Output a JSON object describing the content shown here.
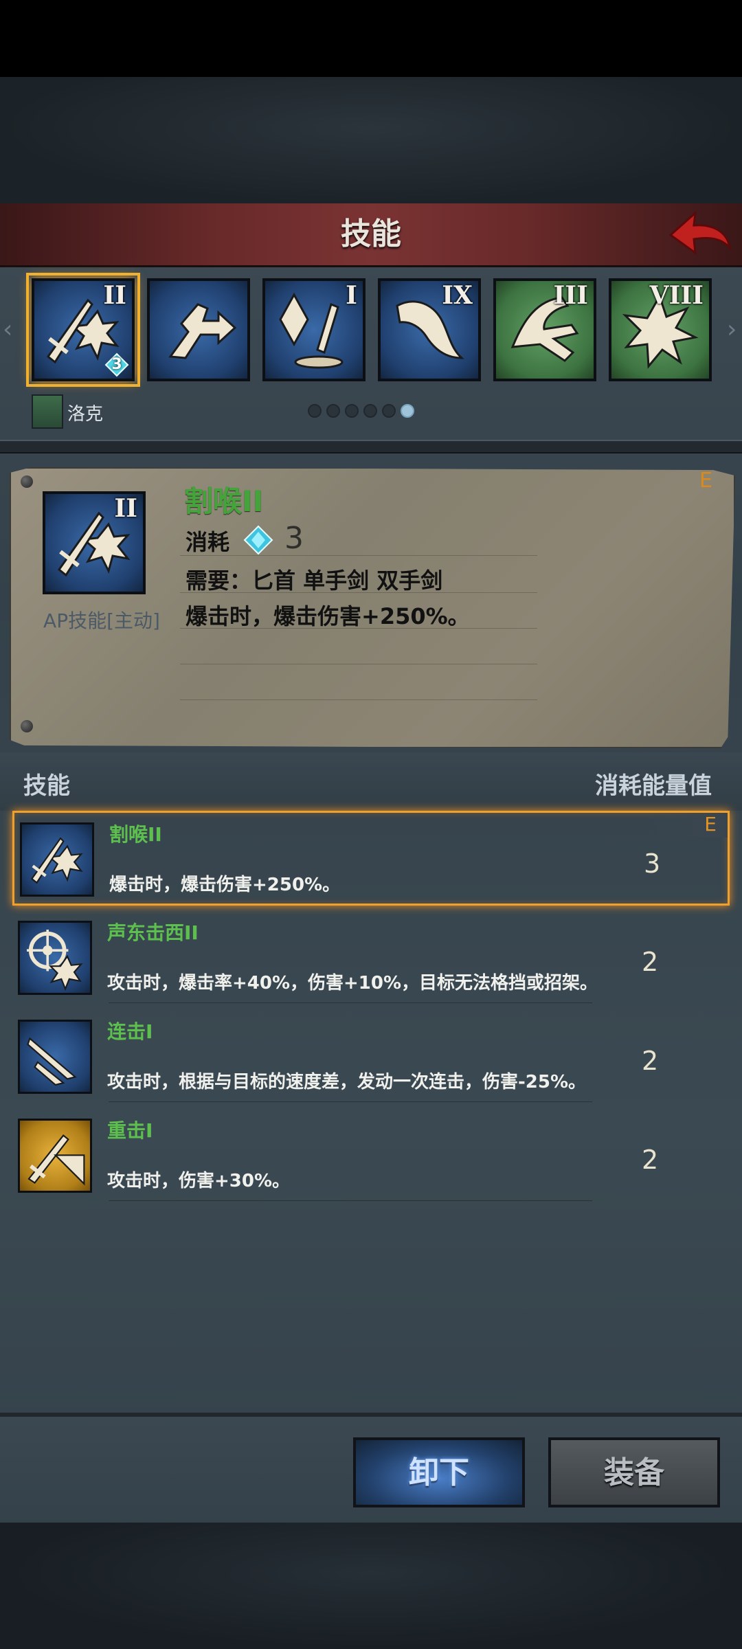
{
  "header": {
    "title": "技能"
  },
  "skill_tiles": [
    {
      "numeral": "II",
      "icon": "slash-burst-icon",
      "color": "blue",
      "selected": true,
      "cost": "3"
    },
    {
      "numeral": "",
      "icon": "dash-arrow-icon",
      "color": "blue",
      "selected": false
    },
    {
      "numeral": "I",
      "icon": "crystal-sword-icon",
      "color": "blue",
      "selected": false
    },
    {
      "numeral": "IX",
      "icon": "beast-claw-icon",
      "color": "blue",
      "selected": false
    },
    {
      "numeral": "III",
      "icon": "leap-icon",
      "color": "green",
      "selected": false
    },
    {
      "numeral": "VIII",
      "icon": "burst-icon",
      "color": "green",
      "selected": false
    }
  ],
  "character": {
    "name": "洛克"
  },
  "pager": {
    "total": 6,
    "active": 5
  },
  "detail": {
    "title": "割喉II",
    "numeral": "II",
    "grade": "E",
    "cost_label": "消耗",
    "cost_value": "3",
    "requirement": "需要：匕首  单手剑  双手剑",
    "effect": "爆击时，爆击伤害+250%。",
    "type": "AP技能[主动]"
  },
  "list_header": {
    "left": "技能",
    "right": "消耗能量值"
  },
  "skills": [
    {
      "name": "割喉II",
      "desc": "爆击时，爆击伤害+250%。",
      "cost": "3",
      "grade": "E",
      "selected": true,
      "icon": "slash-burst-icon",
      "color": "blue"
    },
    {
      "name": "声东击西II",
      "desc": "攻击时，爆击率+40%，伤害+10%，目标无法格挡或招架。",
      "cost": "2",
      "selected": false,
      "icon": "target-burst-icon",
      "color": "blue"
    },
    {
      "name": "连击I",
      "desc": "攻击时，根据与目标的速度差，发动一次连击，伤害-25%。",
      "cost": "2",
      "selected": false,
      "icon": "double-blade-icon",
      "color": "blue"
    },
    {
      "name": "重击I",
      "desc": "攻击时，伤害+30%。",
      "cost": "2",
      "selected": false,
      "icon": "heavy-strike-icon",
      "color": "gold"
    }
  ],
  "buttons": {
    "unequip": "卸下",
    "equip": "装备"
  },
  "colors": {
    "accent_orange": "#f0a02c",
    "skill_name_green": "#5dc04e",
    "header_red": "#7a3333",
    "grade_orange": "#e29422"
  }
}
